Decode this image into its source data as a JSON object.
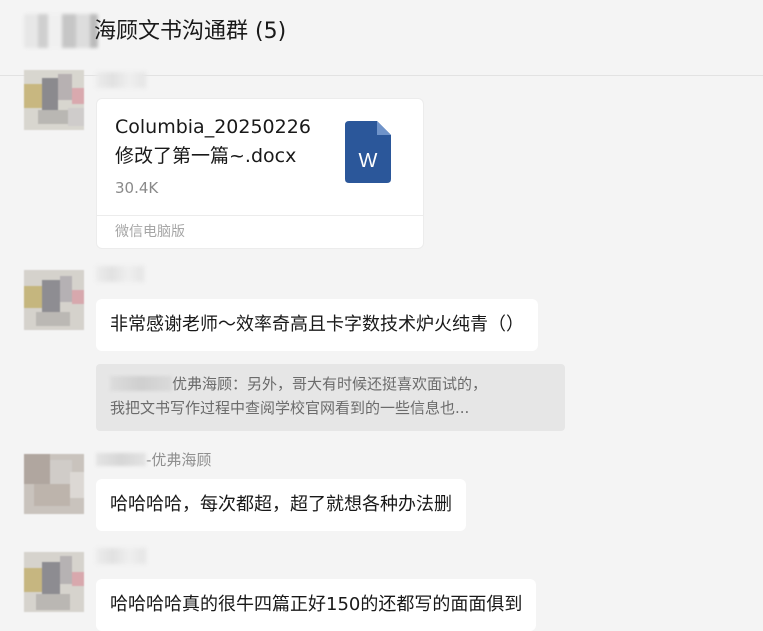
{
  "header": {
    "title": "海顾文书沟通群 (5)"
  },
  "messages": {
    "file": {
      "filename_line1": "Columbia_20250226",
      "filename_line2": "修改了第一篇~.docx",
      "size": "30.4K",
      "source": "微信电脑版",
      "icon_letter": "W",
      "icon_color": "#2b579a"
    },
    "msg2": {
      "text": "非常感谢老师～效率奇高且卡字数技术炉火纯青（）"
    },
    "quote": {
      "line1_after_name": "优弗海顾：另外，哥大有时候还挺喜欢面试的，",
      "line2": "我把文书写作过程中查阅学校官网看到的一些信息也..."
    },
    "msg3": {
      "sender_suffix": "-优弗海顾",
      "text": "哈哈哈哈，每次都超，超了就想各种办法删"
    },
    "msg4": {
      "text": "哈哈哈哈真的很牛四篇正好150的还都写的面面俱到"
    }
  }
}
